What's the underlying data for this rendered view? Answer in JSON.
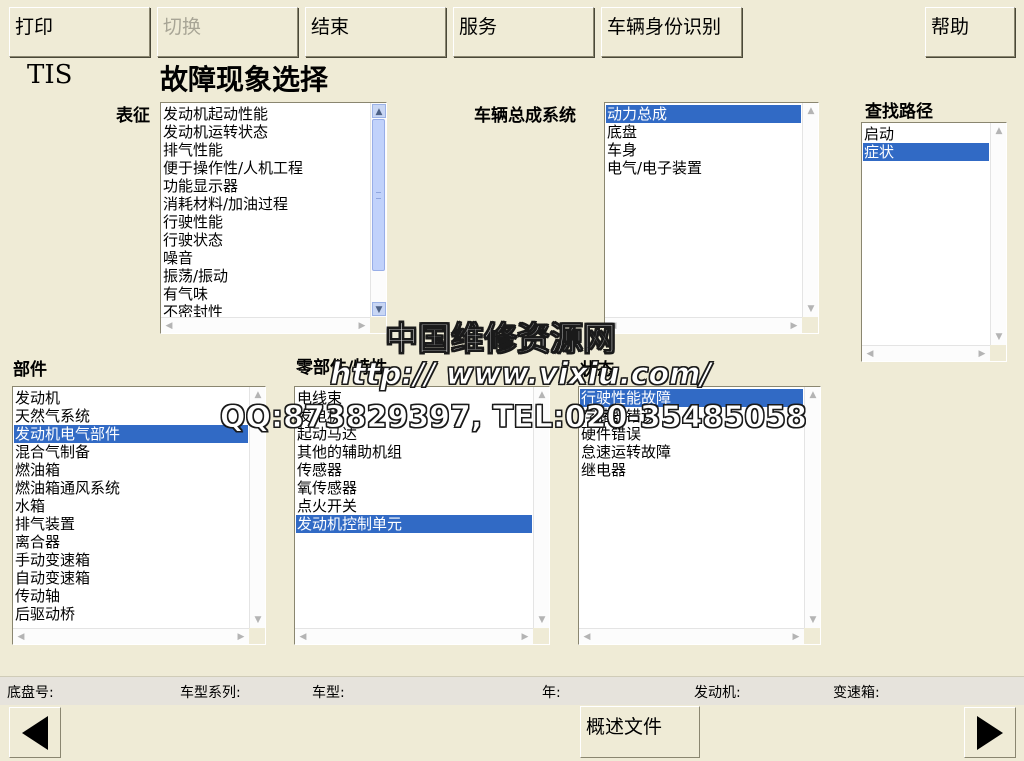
{
  "toolbar": {
    "print": "打印",
    "switch": "切换",
    "end": "结束",
    "service": "服务",
    "vehicle_id": "车辆身份识别",
    "help": "帮助"
  },
  "header": {
    "app_name": "TIS",
    "page_title": "故障现象选择"
  },
  "symptoms": {
    "label": "表征",
    "items": [
      "发动机起动性能",
      "发动机运转状态",
      "排气性能",
      "便于操作性/人机工程",
      "功能显示器",
      "消耗材料/加油过程",
      "行驶性能",
      "行驶状态",
      "噪音",
      "振荡/振动",
      "有气味",
      "不密封性"
    ]
  },
  "assembly": {
    "label": "车辆总成系统",
    "items": [
      "动力总成",
      "底盘",
      "车身",
      "电气/电子装置"
    ],
    "selected": "动力总成"
  },
  "search_path": {
    "label": "查找路径",
    "items": [
      "启动",
      "症状"
    ],
    "selected": "症状"
  },
  "parts": {
    "label": "部件",
    "items": [
      "发动机",
      "天然气系统",
      "发动机电气部件",
      "混合气制备",
      "燃油箱",
      "燃油箱通风系统",
      "水箱",
      "排气装置",
      "离合器",
      "手动变速箱",
      "自动变速箱",
      "传动轴",
      "后驱动桥"
    ],
    "selected": "发动机电气部件"
  },
  "components": {
    "label": "零部件/特性",
    "items": [
      "电线束",
      "发电机",
      "起动马达",
      "其他的辅助机组",
      "传感器",
      "氧传感器",
      "点火开关",
      "发动机控制单元"
    ],
    "selected": "发动机控制单元"
  },
  "state": {
    "label": "状态",
    "items": [
      "行驶性能故障",
      "存储器错误",
      "硬件错误",
      "怠速运转故障",
      "继电器"
    ],
    "selected": "行驶性能故障"
  },
  "statusbar": {
    "chassis": "底盘号:",
    "series": "车型系列:",
    "model": "车型:",
    "year": "年:",
    "engine": "发动机:",
    "gearbox": "变速箱:"
  },
  "bottom": {
    "overview": "概述文件"
  },
  "watermark": {
    "line1": "中国维修资源网",
    "line2": "http:// www.vixiu.com/",
    "line3": "QQ:873829397, TEL:020-35485058"
  },
  "colors": {
    "background": "#efebd6",
    "selection": "#316ac5"
  }
}
